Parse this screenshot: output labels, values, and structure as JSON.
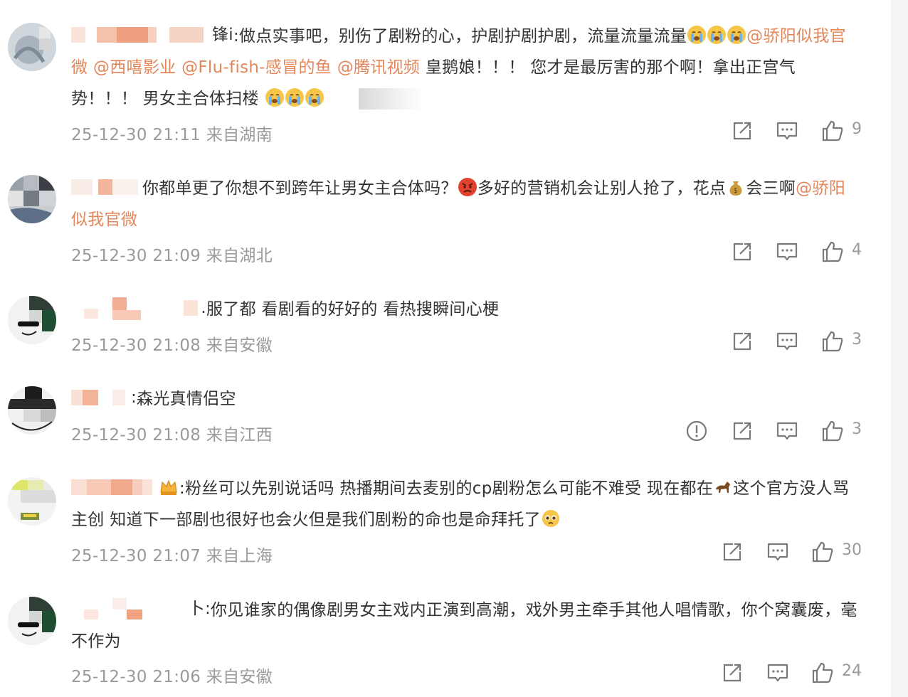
{
  "comments": [
    {
      "name_tail": "锋i",
      "parts": [
        {
          "t": ":做点实事吧，别伤了剧粉的心，护剧护剧护剧，流量流量流量"
        },
        {
          "m": "@骄阳似我官微"
        },
        {
          "t": " "
        },
        {
          "m": "@西嘻影业"
        },
        {
          "t": " "
        },
        {
          "m": "@Flu-fish-感冒的鱼"
        },
        {
          "t": " "
        },
        {
          "m": "@腾讯视频"
        },
        {
          "t": " 皇鹅娘！！！ 您才是最厉害的那个啊！拿出正宫气势！！！ 男女主合体扫楼"
        }
      ],
      "time": "25-12-30 21:11 来自湖南",
      "likes": "9"
    },
    {
      "name_tail": "",
      "parts": [
        {
          "t": "你都单更了你想不到跨年让男女主合体吗？"
        },
        {
          "t": "多好的营销机会让别人抢了，花点"
        },
        {
          "t": "会三啊"
        },
        {
          "m": "@骄阳似我官微"
        }
      ],
      "time": "25-12-30 21:09 来自湖北",
      "likes": "4"
    },
    {
      "name_tail": ".",
      "parts": [
        {
          "t": "服了都 看剧看的好好的 看热搜瞬间心梗"
        }
      ],
      "time": "25-12-30 21:08 来自安徽",
      "likes": "3"
    },
    {
      "name_tail": ":",
      "parts": [
        {
          "t": "森光真情侣空"
        }
      ],
      "time": "25-12-30 21:08 来自江西",
      "likes": "3"
    },
    {
      "name_tail": ":",
      "parts": [
        {
          "t": "粉丝可以先别说话吗 热播期间去麦别的cp剧粉怎么可能不难受 现在都在"
        },
        {
          "t": "这个官方没人骂主创 知道下一部剧也很好也会火但是我们剧粉的命也是命拜托了"
        }
      ],
      "time": "25-12-30 21:07 来自上海",
      "likes": "30"
    },
    {
      "name_tail": "卜:",
      "parts": [
        {
          "t": "你见谁家的偶像剧男女主戏内正演到高潮，戏外男主牵手其他人唱情歌，你个窝囊废，毫不作为"
        }
      ],
      "time": "25-12-30 21:06 来自安徽",
      "likes": "24"
    }
  ],
  "icons": [
    "share-icon",
    "comment-icon",
    "like-icon",
    "report-icon",
    "crying-emoji",
    "angry-emoji",
    "money-bag-emoji",
    "horse-emoji",
    "pleading-emoji",
    "crown-badge-icon"
  ],
  "colors": {
    "mention": "#e3865a",
    "meta": "#9a9a9a",
    "text": "#333333"
  }
}
